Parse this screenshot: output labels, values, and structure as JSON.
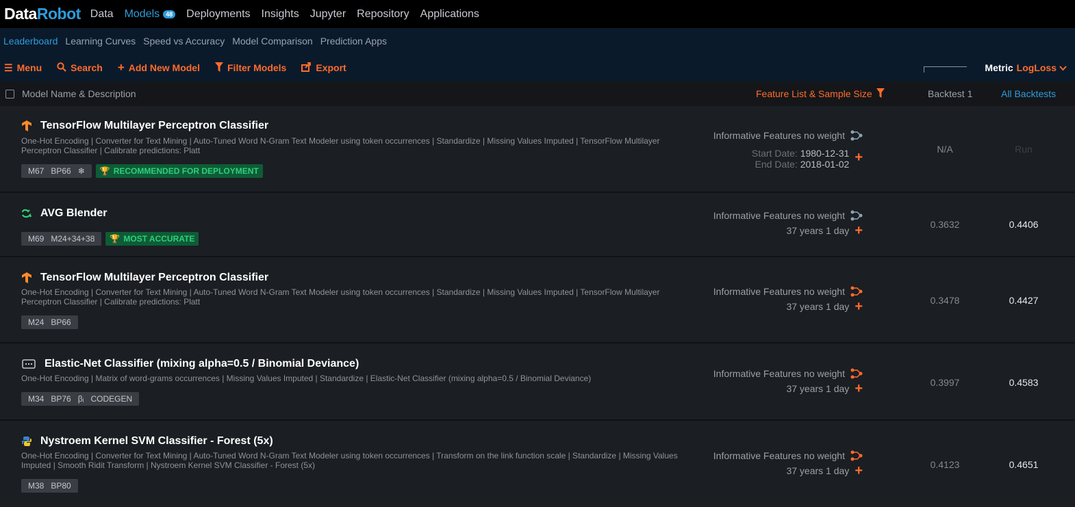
{
  "app": {
    "logo_part1": "Data",
    "logo_part2": "Robot",
    "nav": [
      {
        "label": "Data"
      },
      {
        "label": "Models",
        "badge": "48"
      },
      {
        "label": "Deployments"
      },
      {
        "label": "Insights"
      },
      {
        "label": "Jupyter"
      },
      {
        "label": "Repository"
      },
      {
        "label": "Applications"
      }
    ]
  },
  "subnav": [
    "Leaderboard",
    "Learning Curves",
    "Speed vs Accuracy",
    "Model Comparison",
    "Prediction Apps"
  ],
  "toolbar": {
    "menu": "Menu",
    "search": "Search",
    "add": "Add New Model",
    "filter": "Filter Models",
    "export": "Export",
    "metric_label": "Metric",
    "metric_value": "LogLoss"
  },
  "table_header": {
    "name": "Model Name & Description",
    "feature_list": "Feature List & Sample Size",
    "backtest1": "Backtest 1",
    "all_backtests": "All Backtests"
  },
  "colors": {
    "accent_orange": "#ff6c2c",
    "accent_blue": "#2d9cdb",
    "award_green": "#2fd07a"
  },
  "models": [
    {
      "icon": "tensorflow-icon",
      "title": "TensorFlow Multilayer Perceptron Classifier",
      "description": "One-Hot Encoding | Converter for Text Mining | Auto-Tuned Word N-Gram Text Modeler using token occurrences | Standardize | Missing Values Imputed | TensorFlow Multilayer Perceptron Classifier | Calibrate predictions: Platt",
      "tags": [
        "M67",
        "BP66",
        "❄"
      ],
      "award": "RECOMMENDED FOR DEPLOYMENT",
      "feature_list": "Informative Features no weight",
      "start_label": "Start Date:",
      "start_date": "1980-12-31",
      "end_label": "End Date:",
      "end_date": "2018-01-02",
      "backtest1": "N/A",
      "all_backtests": "Run"
    },
    {
      "icon": "blender-icon",
      "title": "AVG Blender",
      "description": "",
      "tags": [
        "M69",
        "M24+34+38"
      ],
      "award": "MOST ACCURATE",
      "feature_list": "Informative Features no weight",
      "sample": "37 years 1 day",
      "backtest1": "0.3632",
      "all_backtests": "0.4406"
    },
    {
      "icon": "tensorflow-icon",
      "title": "TensorFlow Multilayer Perceptron Classifier",
      "description": "One-Hot Encoding | Converter for Text Mining | Auto-Tuned Word N-Gram Text Modeler using token occurrences | Standardize | Missing Values Imputed | TensorFlow Multilayer Perceptron Classifier | Calibrate predictions: Platt",
      "tags": [
        "M24",
        "BP66"
      ],
      "feature_list": "Informative Features no weight",
      "sample": "37 years 1 day",
      "backtest1": "0.3478",
      "all_backtests": "0.4427"
    },
    {
      "icon": "elasticnet-icon",
      "title": "Elastic-Net Classifier (mixing alpha=0.5 / Binomial Deviance)",
      "description": "One-Hot Encoding | Matrix of word-grams occurrences | Missing Values Imputed | Standardize | Elastic-Net Classifier (mixing alpha=0.5 / Binomial Deviance)",
      "tags": [
        "M34",
        "BP76",
        "βᵢ",
        "CODEGEN"
      ],
      "feature_list": "Informative Features no weight",
      "sample": "37 years 1 day",
      "backtest1": "0.3997",
      "all_backtests": "0.4583"
    },
    {
      "icon": "python-icon",
      "title": "Nystroem Kernel SVM Classifier - Forest (5x)",
      "description": "One-Hot Encoding | Converter for Text Mining | Auto-Tuned Word N-Gram Text Modeler using token occurrences | Transform on the link function scale | Standardize | Missing Values Imputed | Smooth Ridit Transform | Nystroem Kernel SVM Classifier - Forest (5x)",
      "tags": [
        "M38",
        "BP80"
      ],
      "feature_list": "Informative Features no weight",
      "sample": "37 years 1 day",
      "backtest1": "0.4123",
      "all_backtests": "0.4651"
    }
  ]
}
